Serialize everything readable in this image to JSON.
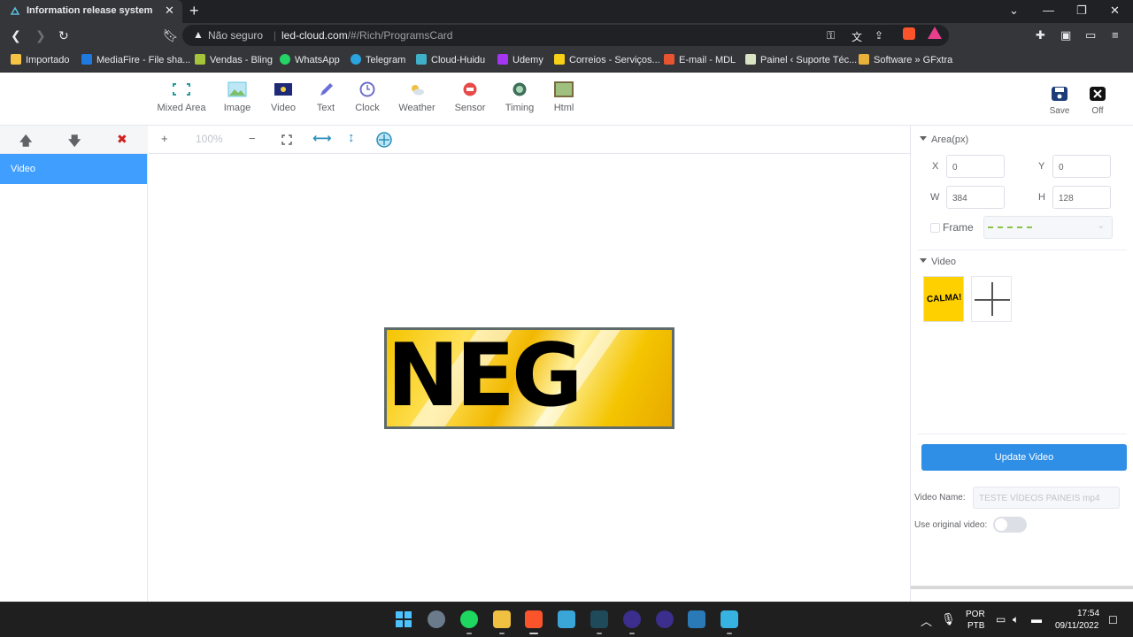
{
  "browser": {
    "tab_title": "Information release system",
    "tab_close": "✕",
    "new_tab": "+",
    "security": "Não seguro",
    "url_domain": "led-cloud.com",
    "url_path": "/#/Rich/ProgramsCard",
    "bookmarks": [
      {
        "label": "Importado",
        "icon": "folder-icon",
        "color": "#f6c445"
      },
      {
        "label": "MediaFire - File sha...",
        "icon": "mediafire-icon",
        "color": "#1f7ae0"
      },
      {
        "label": "Vendas - Bling",
        "icon": "bling-icon",
        "color": "#a6c43b"
      },
      {
        "label": "WhatsApp",
        "icon": "whatsapp-icon",
        "color": "#25d366"
      },
      {
        "label": "Telegram",
        "icon": "telegram-icon",
        "color": "#2aa3de"
      },
      {
        "label": "Cloud-Huidu",
        "icon": "cloud-icon",
        "color": "#40b0c8"
      },
      {
        "label": "Udemy",
        "icon": "udemy-icon",
        "color": "#a435f0"
      },
      {
        "label": "Correios - Serviços...",
        "icon": "correios-icon",
        "color": "#f7d117"
      },
      {
        "label": "E-mail - MDL",
        "icon": "mail-icon",
        "color": "#e8542f"
      },
      {
        "label": "Painel ‹ Suporte Téc...",
        "icon": "painel-icon",
        "color": "#d9e4c4"
      },
      {
        "label": "Software » GFxtra",
        "icon": "gfxtra-icon",
        "color": "#e8b23a"
      }
    ]
  },
  "toolbar": {
    "tools": [
      {
        "label": "Mixed Area",
        "icon": "mixed-area-icon",
        "color": "#2a9a9a"
      },
      {
        "label": "Image",
        "icon": "image-icon",
        "color": "#67c7e0"
      },
      {
        "label": "Video",
        "icon": "video-icon",
        "color": "#2a3a8c"
      },
      {
        "label": "Text",
        "icon": "text-pen-icon",
        "color": "#6a6fd8"
      },
      {
        "label": "Clock",
        "icon": "clock-icon",
        "color": "#6d6fc8"
      },
      {
        "label": "Weather",
        "icon": "weather-icon",
        "color": "#f0c040"
      },
      {
        "label": "Sensor",
        "icon": "sensor-icon",
        "color": "#e84a4a"
      },
      {
        "label": "Timing",
        "icon": "timing-icon",
        "color": "#3f6e5a"
      },
      {
        "label": "Html",
        "icon": "html-icon",
        "color": "#7aa060"
      }
    ],
    "save_label": "Save",
    "off_label": "Off"
  },
  "left_panel": {
    "up": "🡅",
    "down": "🡇",
    "delete": "✖",
    "layers": [
      "Video"
    ]
  },
  "canvas": {
    "zoom_in": "+",
    "zoom_level": "100%",
    "zoom_out": "−",
    "video_text": "NEG"
  },
  "properties": {
    "area_title": "Area(px)",
    "x_label": "X",
    "x_value": "0",
    "y_label": "Y",
    "y_value": "0",
    "w_label": "W",
    "w_value": "384",
    "h_label": "H",
    "h_value": "128",
    "frame_label": "Frame",
    "video_title": "Video",
    "thumb_text": "CALMA!",
    "update_button": "Update Video",
    "video_name_label": "Video Name:",
    "video_name_value": "TESTE VÍDEOS PAINEIS mp4",
    "use_original_label": "Use original video:",
    "use_original_on": false
  },
  "taskbar": {
    "lang_top": "POR",
    "lang_bottom": "PTB",
    "time": "17:54",
    "date": "09/11/2022"
  }
}
